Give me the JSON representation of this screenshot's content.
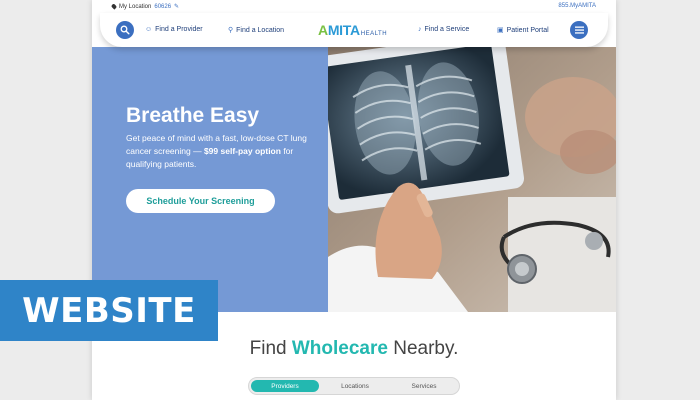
{
  "utility": {
    "location_label": "My Location",
    "zip": "60626",
    "phone": "855.MyAMITA"
  },
  "nav": {
    "items": [
      "Find a Provider",
      "Find a Location",
      "Find a Service",
      "Patient Portal"
    ],
    "logo_a": "A",
    "logo_mita": "MITA",
    "logo_health": "HEALTH"
  },
  "hero": {
    "title": "Breathe Easy",
    "body_start": "Get peace of mind with a fast, low-dose CT lung cancer screening — ",
    "body_bold": "$99 self-pay option",
    "body_end": " for qualifying patients.",
    "cta": "Schedule Your Screening"
  },
  "find": {
    "prefix": "Find ",
    "highlight": "Wholecare",
    "suffix": " Nearby."
  },
  "tabs": [
    "Providers",
    "Locations",
    "Services"
  ],
  "active_tab": "Providers",
  "badge": "WEBSITE",
  "colors": {
    "hero_blue": "#7599d5",
    "accent_teal": "#23b8b0",
    "nav_blue": "#3b6fc0",
    "badge_blue": "#2f84c8"
  }
}
